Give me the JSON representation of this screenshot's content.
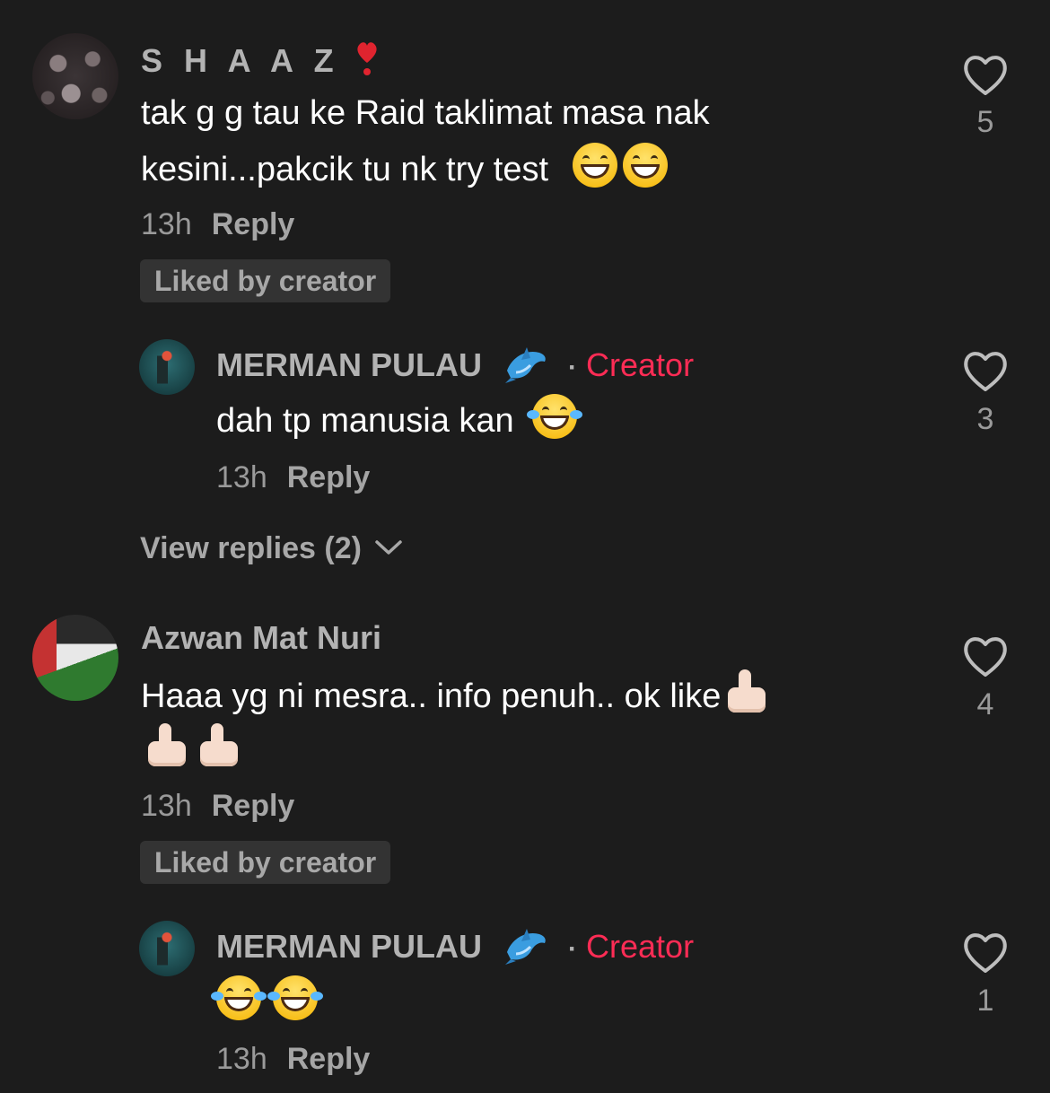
{
  "comments": [
    {
      "username": "S H A A Z",
      "username_badge": "heart-exclamation-emoji",
      "text_line1": "tak g g tau ke Raid taklimat masa nak",
      "text_line2": "kesini...pakcik tu nk try test",
      "emojis": [
        "grinning-face-with-smiling-eyes",
        "grinning-face-with-smiling-eyes"
      ],
      "time": "13h",
      "reply_label": "Reply",
      "liked_by_creator": "Liked by creator",
      "like_count": "5",
      "replies": [
        {
          "username": "MERMAN PULAU",
          "username_badge": "dolphin-emoji",
          "creator_label": "Creator",
          "text": "dah tp manusia kan",
          "emojis": [
            "face-with-tears-of-joy"
          ],
          "time": "13h",
          "reply_label": "Reply",
          "like_count": "3"
        }
      ],
      "view_replies_label": "View replies (2)"
    },
    {
      "username": "Azwan Mat Nuri",
      "text_line1": "Haaa yg ni mesra.. info penuh.. ok like",
      "emojis": [
        "thumbs-up-light-skin",
        "thumbs-up-light-skin",
        "thumbs-up-light-skin"
      ],
      "time": "13h",
      "reply_label": "Reply",
      "liked_by_creator": "Liked by creator",
      "like_count": "4",
      "replies": [
        {
          "username": "MERMAN PULAU",
          "username_badge": "dolphin-emoji",
          "creator_label": "Creator",
          "text": "",
          "emojis": [
            "face-with-tears-of-joy",
            "face-with-tears-of-joy"
          ],
          "time": "13h",
          "reply_label": "Reply",
          "like_count": "1"
        }
      ]
    }
  ],
  "separator": "·",
  "colors": {
    "background": "#1c1c1c",
    "creator_accent": "#fe2c55",
    "muted_text": "#9a9a9a",
    "liked_badge_bg": "#333333"
  }
}
